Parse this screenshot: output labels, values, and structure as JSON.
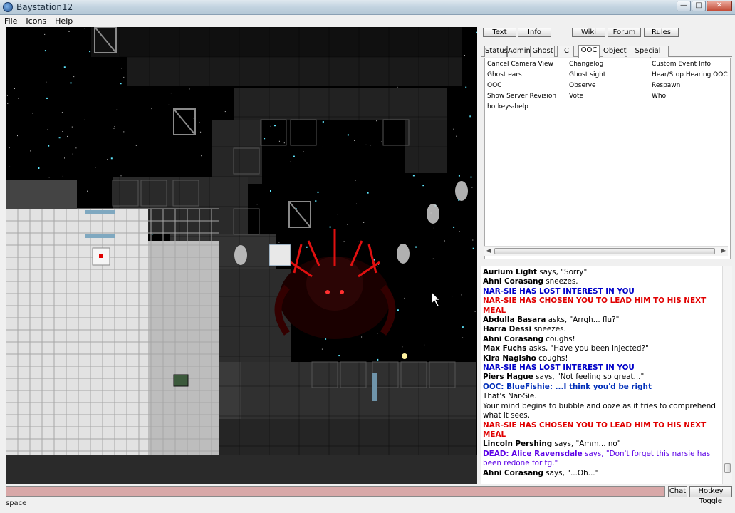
{
  "window": {
    "title": "Baystation12"
  },
  "menu": [
    "File",
    "Icons",
    "Help"
  ],
  "top_buttons": [
    "Text",
    "Info",
    "Wiki",
    "Forum",
    "Rules"
  ],
  "tabs": [
    "Status",
    "Admin",
    "Ghost",
    "IC",
    "OOC",
    "Object",
    "Special Verbs"
  ],
  "active_tab": "OOC",
  "verbs": [
    "Cancel Camera View",
    "Changelog",
    "Custom Event Info",
    "Ghost ears",
    "Ghost sight",
    "Hear/Stop Hearing OOC",
    "OOC",
    "Observe",
    "Respawn",
    "Show Server Revision",
    "Vote",
    "Who",
    "hotkeys-help"
  ],
  "chat": [
    {
      "name": "Aurium Light",
      "text": " says, \"Sorry\""
    },
    {
      "name": "Ahni Corasang",
      "text": " sneezes."
    },
    {
      "blue": "NAR-SIE HAS LOST INTEREST IN YOU"
    },
    {
      "red": "NAR-SIE HAS CHOSEN YOU TO LEAD HIM TO HIS NEXT MEAL"
    },
    {
      "name": "Abdulla Basara",
      "text": " asks, \"Arrgh... flu?\""
    },
    {
      "name": "Harra Dessi",
      "text": " sneezes."
    },
    {
      "name": "Ahni Corasang",
      "text": " coughs!"
    },
    {
      "name": "Max Fuchs",
      "text": " asks, \"Have you been injected?\""
    },
    {
      "name": "Kira Nagisho",
      "text": " coughs!"
    },
    {
      "blue": "NAR-SIE HAS LOST INTEREST IN YOU"
    },
    {
      "name": "Piers Hague",
      "text": " says, \"Not feeling so great...\""
    },
    {
      "ooc": "OOC: BlueFishie: ...I think you'd be right"
    },
    {
      "plain": "That's Nar-Sie."
    },
    {
      "plain": "Your mind begins to bubble and ooze as it tries to comprehend what it sees."
    },
    {
      "red": "NAR-SIE HAS CHOSEN YOU TO LEAD HIM TO HIS NEXT MEAL"
    },
    {
      "name": "Lincoln Pershing",
      "text": " says, \"Amm... no\""
    },
    {
      "dead_prefix": "DEAD: Alice Ravensdale",
      "dead_text": " says, \"Don't forget this narsie has been redone for tg.\""
    },
    {
      "name": "Ahni Corasang",
      "text": " says, \"...Oh...\""
    }
  ],
  "input": {
    "value": ""
  },
  "bottom_buttons": [
    "Chat",
    "Hotkey Toggle"
  ],
  "status_text": "space",
  "colors": {
    "alert_red": "#e00000",
    "alert_blue": "#0000c8",
    "dead_purple": "#5c00e6",
    "input_bg": "#d8a8a8"
  }
}
